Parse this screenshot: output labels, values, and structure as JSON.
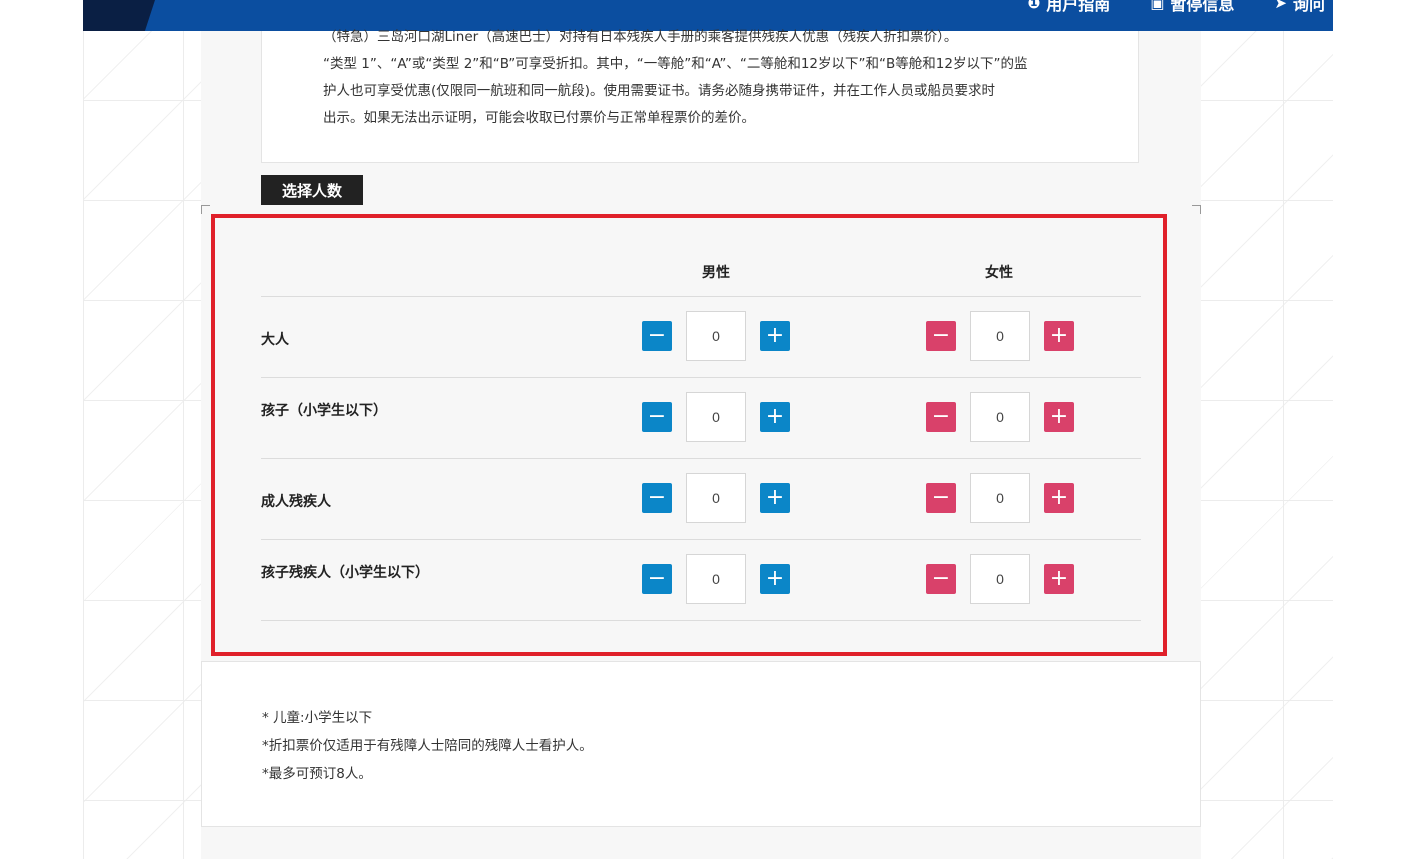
{
  "header": {
    "nav": [
      {
        "icon": "info-icon",
        "label": "用户指南"
      },
      {
        "icon": "bus-icon",
        "label": "暂停信息"
      },
      {
        "icon": "send-icon",
        "label": "询问"
      }
    ]
  },
  "notice": {
    "lines": [
      "（特急）三岛河口湖Liner（高速巴士）对持有日本残疾人手册的乘客提供残疾人优惠（残疾人折扣票价）。",
      "“类型 1”、“A”或“类型 2”和“B”可享受折扣。其中，“一等舱”和“A”、“二等舱和12岁以下”和“B等舱和12岁以下”的监",
      "护人也可享受优惠(仅限同一航班和同一航段)。使用需要证书。请务必随身携带证件，并在工作人员或船员要求时",
      "出示。如果无法出示证明，可能会收取已付票价与正常单程票价的差价。"
    ]
  },
  "passenger_section": {
    "title": "选择人数",
    "columns": {
      "male": "男性",
      "female": "女性"
    },
    "rows": [
      {
        "label": "大人",
        "male": "0",
        "female": "0"
      },
      {
        "label": "孩子（小学生以下）",
        "male": "0",
        "female": "0"
      },
      {
        "label": "成人残疾人",
        "male": "0",
        "female": "0"
      },
      {
        "label": "孩子残疾人（小学生以下）",
        "male": "0",
        "female": "0"
      }
    ],
    "controls": {
      "minus": "−",
      "plus": "+"
    }
  },
  "notes": [
    "* 儿童:小学生以下",
    "*折扣票价仅适用于有残障人士陪同的残障人士看护人。",
    "*最多可预订8人。"
  ],
  "colors": {
    "header_blue": "#0b4ea0",
    "male_button": "#0b86c8",
    "female_button": "#d9416a",
    "highlight": "#e0202a"
  }
}
